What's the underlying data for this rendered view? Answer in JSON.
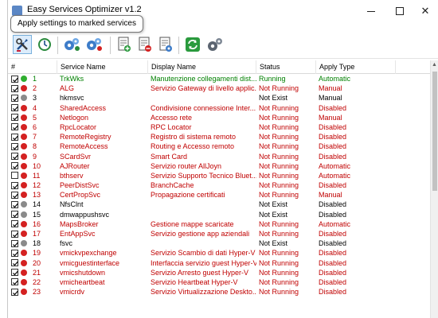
{
  "window": {
    "title": "Easy Services Optimizer v1.2"
  },
  "tooltip": {
    "text": "Apply settings to marked services"
  },
  "colors": {
    "green_text": "#008000",
    "red_text": "#c00000",
    "black_text": "#000000",
    "dot_green": "#2fae2f",
    "dot_red": "#d42121",
    "dot_grey": "#8a8a8a"
  },
  "toolbar": {
    "buttons": [
      {
        "icon": "apply-settings-icon"
      },
      {
        "icon": "clock-icon"
      },
      {
        "icon": "gears-blue-icon"
      },
      {
        "icon": "gears-red-icon"
      },
      {
        "icon": "add-document-icon"
      },
      {
        "icon": "remove-document-icon"
      },
      {
        "icon": "settings-document-icon"
      },
      {
        "icon": "refresh-icon"
      },
      {
        "icon": "settings-gear-icon"
      }
    ]
  },
  "grid": {
    "columns": [
      "#",
      "Service Name",
      "Display Name",
      "Status",
      "Apply Type"
    ],
    "rows": [
      {
        "checked": true,
        "dot": "green",
        "color": "green",
        "num": "1",
        "service": "TrkWks",
        "display": "Manutenzione collegamenti dist...",
        "status": "Running",
        "apply": "Automatic"
      },
      {
        "checked": true,
        "dot": "red",
        "color": "red",
        "num": "2",
        "service": "ALG",
        "display": "Servizio Gateway di livello applic...",
        "status": "Not Running",
        "apply": "Manual"
      },
      {
        "checked": true,
        "dot": "grey",
        "color": "black",
        "num": "3",
        "service": "hkmsvc",
        "display": "",
        "status": "Not Exist",
        "apply": "Manual"
      },
      {
        "checked": true,
        "dot": "red",
        "color": "red",
        "num": "4",
        "service": "SharedAccess",
        "display": "Condivisione connessione Inter...",
        "status": "Not Running",
        "apply": "Disabled"
      },
      {
        "checked": true,
        "dot": "red",
        "color": "red",
        "num": "5",
        "service": "Netlogon",
        "display": "Accesso rete",
        "status": "Not Running",
        "apply": "Manual"
      },
      {
        "checked": true,
        "dot": "red",
        "color": "red",
        "num": "6",
        "service": "RpcLocator",
        "display": "RPC Locator",
        "status": "Not Running",
        "apply": "Disabled"
      },
      {
        "checked": true,
        "dot": "red",
        "color": "red",
        "num": "7",
        "service": "RemoteRegistry",
        "display": "Registro di sistema remoto",
        "status": "Not Running",
        "apply": "Disabled"
      },
      {
        "checked": true,
        "dot": "red",
        "color": "red",
        "num": "8",
        "service": "RemoteAccess",
        "display": "Routing e Accesso remoto",
        "status": "Not Running",
        "apply": "Disabled"
      },
      {
        "checked": true,
        "dot": "red",
        "color": "red",
        "num": "9",
        "service": "SCardSvr",
        "display": "Smart Card",
        "status": "Not Running",
        "apply": "Disabled"
      },
      {
        "checked": true,
        "dot": "red",
        "color": "red",
        "num": "10",
        "service": "AJRouter",
        "display": "Servizio router AllJoyn",
        "status": "Not Running",
        "apply": "Automatic"
      },
      {
        "checked": false,
        "dot": "red",
        "color": "red",
        "num": "11",
        "service": "bthserv",
        "display": "Servizio Supporto Tecnico Bluet...",
        "status": "Not Running",
        "apply": "Automatic"
      },
      {
        "checked": true,
        "dot": "red",
        "color": "red",
        "num": "12",
        "service": "PeerDistSvc",
        "display": "BranchCache",
        "status": "Not Running",
        "apply": "Disabled"
      },
      {
        "checked": true,
        "dot": "red",
        "color": "red",
        "num": "13",
        "service": "CertPropSvc",
        "display": "Propagazione certificati",
        "status": "Not Running",
        "apply": "Manual"
      },
      {
        "checked": true,
        "dot": "grey",
        "color": "black",
        "num": "14",
        "service": "NfsClnt",
        "display": "",
        "status": "Not Exist",
        "apply": "Disabled"
      },
      {
        "checked": true,
        "dot": "grey",
        "color": "black",
        "num": "15",
        "service": "dmwappushsvc",
        "display": "",
        "status": "Not Exist",
        "apply": "Disabled"
      },
      {
        "checked": true,
        "dot": "red",
        "color": "red",
        "num": "16",
        "service": "MapsBroker",
        "display": "Gestione mappe scaricate",
        "status": "Not Running",
        "apply": "Automatic"
      },
      {
        "checked": true,
        "dot": "red",
        "color": "red",
        "num": "17",
        "service": "EntAppSvc",
        "display": "Servizio gestione app aziendali",
        "status": "Not Running",
        "apply": "Disabled"
      },
      {
        "checked": true,
        "dot": "grey",
        "color": "black",
        "num": "18",
        "service": "fsvc",
        "display": "",
        "status": "Not Exist",
        "apply": "Disabled"
      },
      {
        "checked": true,
        "dot": "red",
        "color": "red",
        "num": "19",
        "service": "vmickvpexchange",
        "display": "Servizio Scambio di dati Hyper-V",
        "status": "Not Running",
        "apply": "Disabled"
      },
      {
        "checked": true,
        "dot": "red",
        "color": "red",
        "num": "20",
        "service": "vmicguestinterface",
        "display": "Interfaccia servizio guest Hyper-V",
        "status": "Not Running",
        "apply": "Disabled"
      },
      {
        "checked": true,
        "dot": "red",
        "color": "red",
        "num": "21",
        "service": "vmicshutdown",
        "display": "Servizio Arresto guest Hyper-V",
        "status": "Not Running",
        "apply": "Disabled"
      },
      {
        "checked": true,
        "dot": "red",
        "color": "red",
        "num": "22",
        "service": "vmicheartbeat",
        "display": "Servizio Heartbeat Hyper-V",
        "status": "Not Running",
        "apply": "Disabled"
      },
      {
        "checked": true,
        "dot": "red",
        "color": "red",
        "num": "23",
        "service": "vmicrdv",
        "display": "Servizio Virtualizzazione Deskto...",
        "status": "Not Running",
        "apply": "Disabled"
      }
    ]
  }
}
